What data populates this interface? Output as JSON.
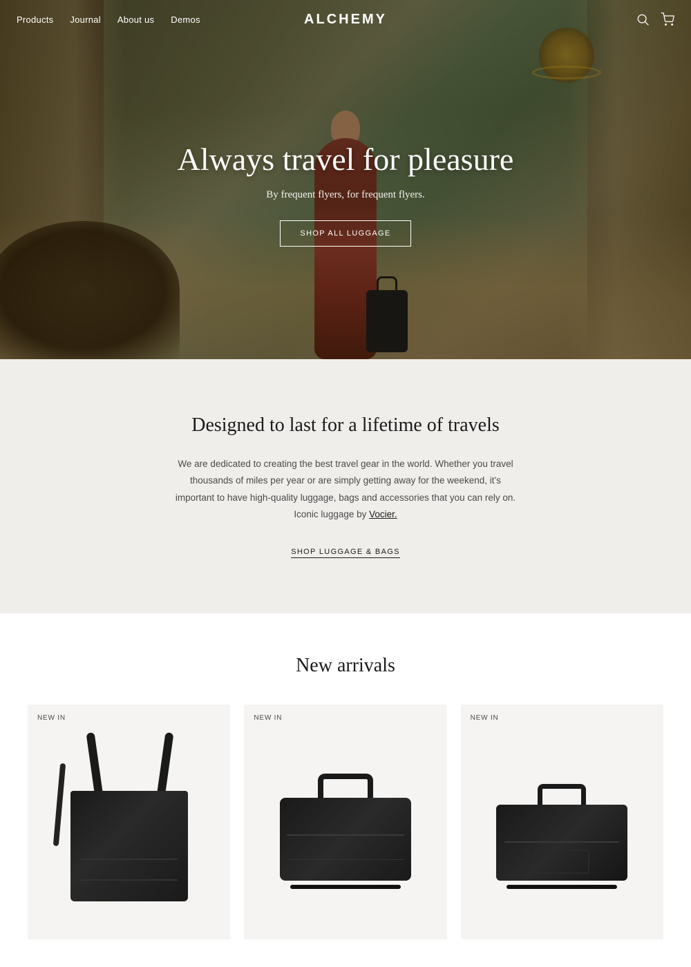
{
  "nav": {
    "brand": "ALCHEMY",
    "links": [
      {
        "id": "products",
        "label": "Products"
      },
      {
        "id": "journal",
        "label": "Journal"
      },
      {
        "id": "about",
        "label": "About us"
      },
      {
        "id": "demos",
        "label": "Demos"
      }
    ]
  },
  "hero": {
    "title": "Always travel for pleasure",
    "subtitle": "By frequent flyers, for frequent flyers.",
    "cta_label": "SHOP ALL LUGGAGE"
  },
  "designed_section": {
    "heading": "Designed to last for a lifetime of travels",
    "body": "We are dedicated to creating the best travel gear in the world. Whether you travel thousands of miles per year or are simply getting away for the weekend, it’s important to have high-quality luggage, bags and accessories that you can rely on. Iconic luggage by",
    "brand_link_label": "Vocier.",
    "shop_link_label": "SHOP LUGGAGE & BAGS"
  },
  "new_arrivals": {
    "heading": "New arrivals",
    "badge": "NEW IN",
    "products": [
      {
        "id": "product-1",
        "badge": "NEW IN",
        "type": "tote"
      },
      {
        "id": "product-2",
        "badge": "NEW IN",
        "type": "duffle1"
      },
      {
        "id": "product-3",
        "badge": "NEW IN",
        "type": "duffle2"
      }
    ]
  }
}
